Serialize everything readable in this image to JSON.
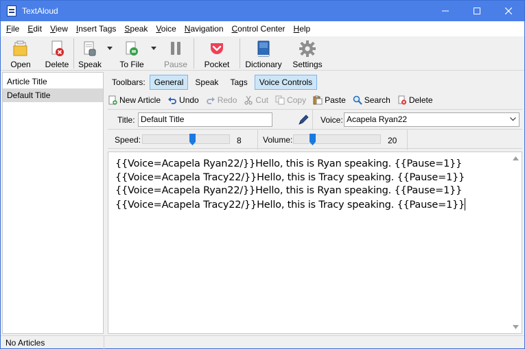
{
  "window": {
    "title": "TextAloud"
  },
  "menu": [
    {
      "label": "File",
      "u": "F",
      "rest": "ile"
    },
    {
      "label": "Edit",
      "u": "E",
      "rest": "dit"
    },
    {
      "label": "View",
      "u": "V",
      "rest": "iew"
    },
    {
      "label": "Insert Tags",
      "u": "I",
      "rest": "nsert Tags"
    },
    {
      "label": "Speak",
      "u": "S",
      "rest": "peak"
    },
    {
      "label": "Voice",
      "u": "V",
      "rest": "oice"
    },
    {
      "label": "Navigation",
      "u": "N",
      "rest": "avigation"
    },
    {
      "label": "Control Center",
      "u": "C",
      "rest": "ontrol Center"
    },
    {
      "label": "Help",
      "u": "H",
      "rest": "elp"
    }
  ],
  "toolbar": {
    "open": "Open",
    "delete": "Delete",
    "speak": "Speak",
    "to_file": "To File",
    "pause": "Pause",
    "pocket": "Pocket",
    "dictionary": "Dictionary",
    "settings": "Settings"
  },
  "articles": {
    "items": [
      "Article Title",
      "Default Title"
    ],
    "selected_index": 1
  },
  "panel": {
    "toolbars_label": "Toolbars:",
    "tabs": [
      "General",
      "Speak",
      "Tags",
      "Voice Controls"
    ],
    "active_tabs": [
      "General",
      "Voice Controls"
    ],
    "actions": {
      "new_article": "New Article",
      "undo": "Undo",
      "redo": "Redo",
      "cut": "Cut",
      "copy": "Copy",
      "paste": "Paste",
      "search": "Search",
      "delete": "Delete"
    },
    "title_label": "Title:",
    "title_value": "Default Title",
    "voice_label": "Voice:",
    "voice_value": "Acapela Ryan22",
    "speed_label": "Speed:",
    "speed_value": "8",
    "speed_fraction": 0.58,
    "volume_label": "Volume:",
    "volume_value": "20",
    "volume_fraction": 0.2
  },
  "editor": {
    "lines": [
      "{{Voice=Acapela Ryan22/}}Hello, this is Ryan speaking. {{Pause=1}}",
      "{{Voice=Acapela Tracy22/}}Hello, this is Tracy speaking. {{Pause=1}}",
      "{{Voice=Acapela Ryan22/}}Hello, this is Ryan speaking. {{Pause=1}}",
      "{{Voice=Acapela Tracy22/}}Hello, this is Tracy speaking. {{Pause=1}}"
    ]
  },
  "status": {
    "text": "No Articles"
  },
  "colors": {
    "titlebar": "#4a7fe8",
    "tab_active": "#cde6f7",
    "slider_thumb": "#1a7ae0"
  }
}
